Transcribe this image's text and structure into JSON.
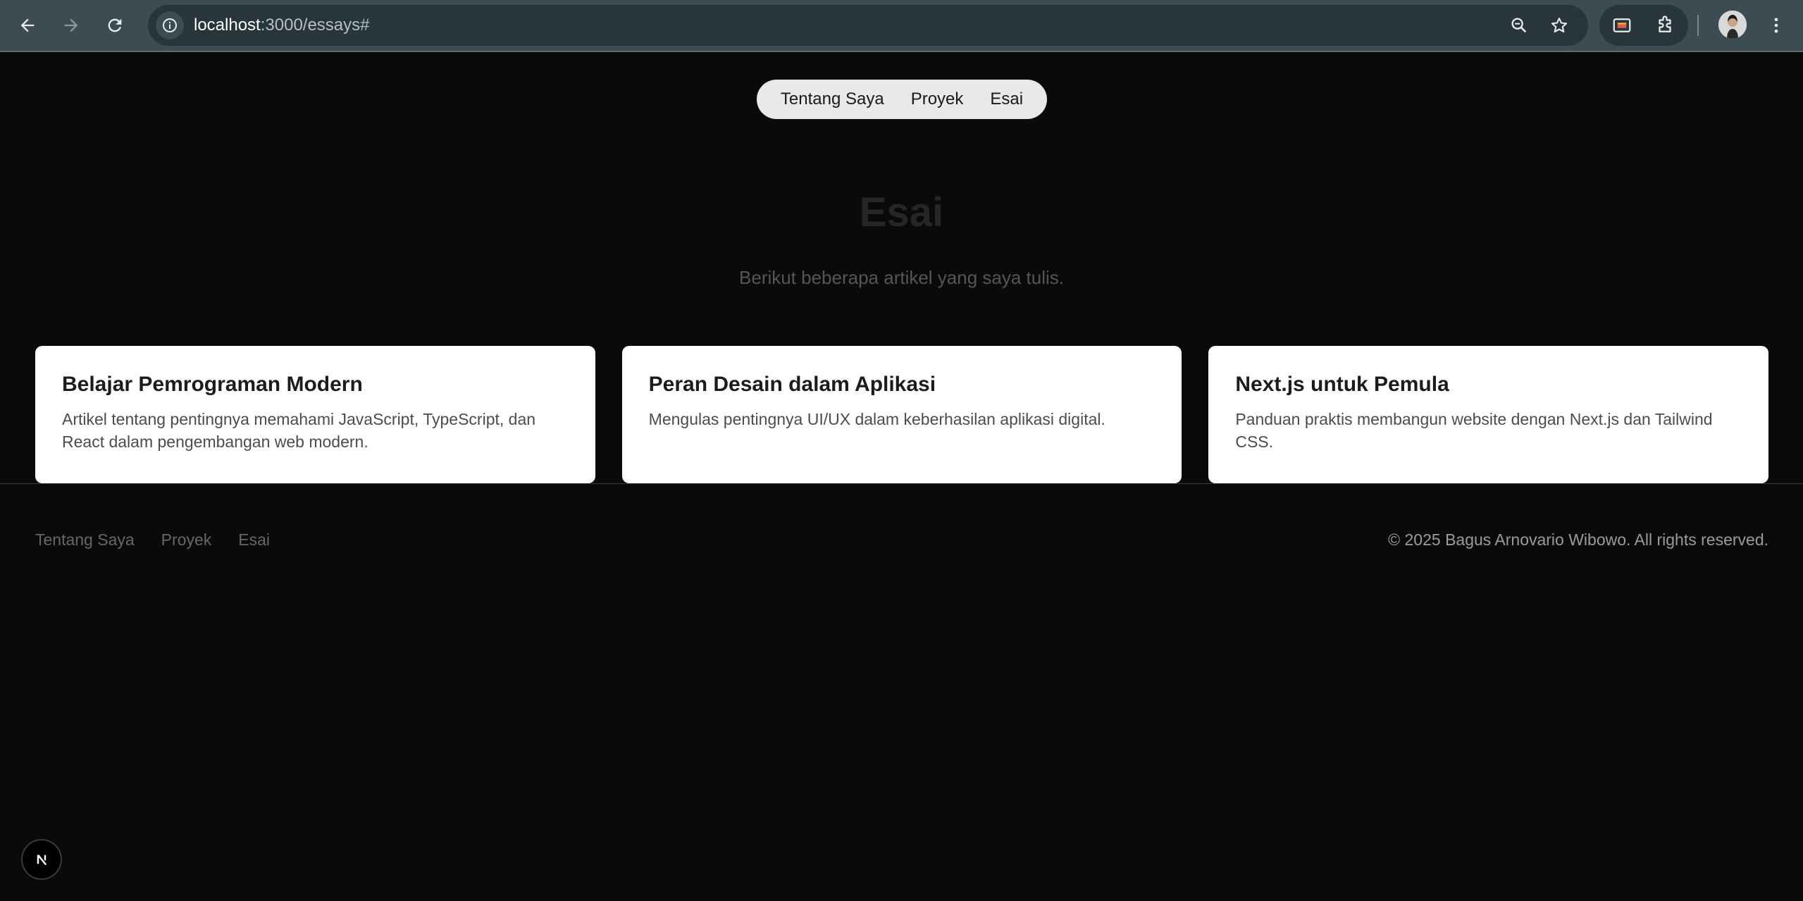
{
  "browser": {
    "url_host": "localhost",
    "url_path": ":3000/essays#",
    "icons": {
      "back": "arrow-left-icon",
      "forward": "arrow-right-icon",
      "reload": "reload-icon",
      "site_info": "info-icon",
      "zoom": "zoom-icon",
      "bookmark": "star-icon",
      "extension_1": "cast-icon",
      "extension_2": "puzzle-icon",
      "menu": "kebab-menu-icon"
    }
  },
  "nav": {
    "items": [
      "Tentang Saya",
      "Proyek",
      "Esai"
    ]
  },
  "hero": {
    "title": "Esai",
    "subtitle": "Berikut beberapa artikel yang saya tulis."
  },
  "essays": [
    {
      "title": "Belajar Pemrograman Modern",
      "description": "Artikel tentang pentingnya memahami JavaScript, TypeScript, dan React dalam pengembangan web modern."
    },
    {
      "title": "Peran Desain dalam Aplikasi",
      "description": "Mengulas pentingnya UI/UX dalam keberhasilan aplikasi digital."
    },
    {
      "title": "Next.js untuk Pemula",
      "description": "Panduan praktis membangun website dengan Next.js dan Tailwind CSS."
    }
  ],
  "footer": {
    "links": [
      "Tentang Saya",
      "Proyek",
      "Esai"
    ],
    "copyright": "© 2025 Bagus Arnovario Wibowo. All rights reserved."
  },
  "dev_badge": {
    "icon": "nextjs-logo-icon"
  },
  "colors": {
    "page_background": "#0a0a0a",
    "chrome_toolbar": "#3c4c52",
    "card_background": "#ffffff",
    "nav_pill": "#e9e9e9"
  }
}
